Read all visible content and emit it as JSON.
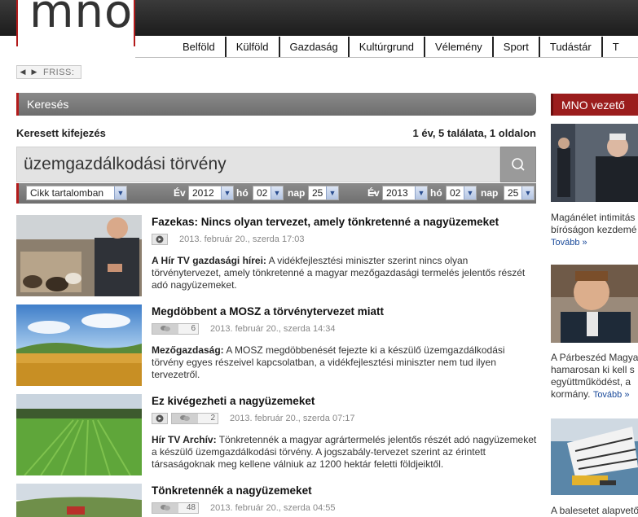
{
  "logo": "mno",
  "nav": [
    "Belföld",
    "Külföld",
    "Gazdaság",
    "Kultúrgrund",
    "Vélemény",
    "Sport",
    "Tudástár",
    "T"
  ],
  "friss": {
    "label": "FRISS:"
  },
  "search": {
    "header": "Keresés",
    "expression_label": "Keresett kifejezés",
    "result_summary": "1 év, 5 találata, 1 oldalon",
    "query": "üzemgazdálkodási törvény"
  },
  "filters": {
    "type": "Cikk tartalomban",
    "ev_label": "Év",
    "ho_label": "hó",
    "nap_label": "nap",
    "from": {
      "year": "2012",
      "month": "02",
      "day": "25"
    },
    "to": {
      "year": "2013",
      "month": "02",
      "day": "25"
    }
  },
  "articles": [
    {
      "title": "Fazekas: Nincs olyan tervezet, amely tönkretenné a nagyüzemeket",
      "has_video": true,
      "comments": null,
      "date": "2013. február 20., szerda 17:03",
      "source": "A Hír TV gazdasági hírei:",
      "lines": [
        "A vidékfejlesztési miniszter szerint nincs olyan",
        "törvénytervezet, amely tönkretenné a magyar mezőgazdasági termelés jelentős részét",
        "adó nagyüzemeket."
      ]
    },
    {
      "title": "Megdöbbent a MOSZ a törvénytervezet miatt",
      "has_video": false,
      "comments": "6",
      "date": "2013. február 20., szerda 14:34",
      "source": "Mezőgazdaság:",
      "lines": [
        "A MOSZ megdöbbenését fejezte ki a készülő üzemgazdálkodási",
        "törvény egyes részeivel kapcsolatban, a vidékfejlesztési miniszter nem tud ilyen",
        "tervezetről."
      ]
    },
    {
      "title": "Ez kivégezheti a nagyüzemeket",
      "has_video": true,
      "comments": "2",
      "date": "2013. február 20., szerda 07:17",
      "source": "Hír TV Archív:",
      "lines": [
        "Tönkretennék a magyar agrártermelés jelentős részét adó nagyüzemeket",
        "a készülő üzemgazdálkodási törvény. A jogszabály-tervezet szerint az érintett",
        "társaságoknak meg kellene válniuk az 1200 hektár feletti földjeiktől."
      ]
    },
    {
      "title": "Tönkretennék a nagyüzemeket",
      "has_video": false,
      "comments": "48",
      "date": "2013. február 20., szerda 04:55",
      "source": "",
      "lines": []
    }
  ],
  "sidebar": {
    "header": "MNO vezető",
    "tovabb": "Tovább",
    "items": [
      {
        "lines": [
          "Magánélet intimitás",
          "bíróságon kezdemé"
        ],
        "tovabb_inline": false
      },
      {
        "lines": [
          "A Párbeszéd Magya",
          "hamarosan ki kell s",
          "együttműködést, a",
          "kormány."
        ],
        "tovabb_inline": true
      },
      {
        "lines": [
          "A balesetet alapvető"
        ],
        "tovabb_inline": false
      }
    ]
  }
}
